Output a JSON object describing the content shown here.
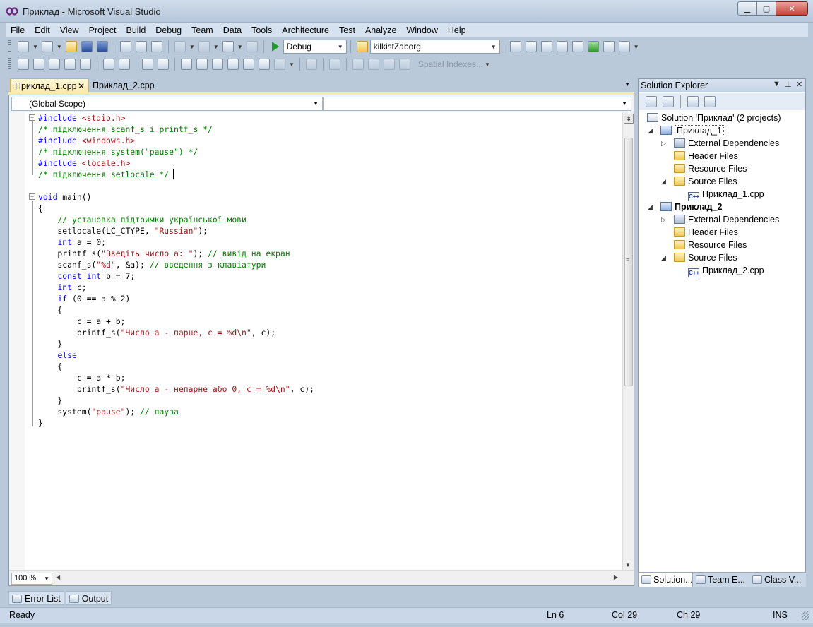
{
  "window": {
    "title": "Приклад - Microsoft Visual Studio",
    "minimize": "▁",
    "maximize": "▢",
    "close": "✕"
  },
  "menu": [
    "File",
    "Edit",
    "View",
    "Project",
    "Build",
    "Debug",
    "Team",
    "Data",
    "Tools",
    "Architecture",
    "Test",
    "Analyze",
    "Window",
    "Help"
  ],
  "toolbar": {
    "configuration": "Debug",
    "find_combo": "kilkistZaborg",
    "spatial_indexes": "Spatial Indexes..."
  },
  "tabs": [
    {
      "label": "Приклад_1.cpp",
      "active": true
    },
    {
      "label": "Приклад_2.cpp",
      "active": false
    }
  ],
  "editor": {
    "scope_left": "(Global Scope)",
    "scope_right": "",
    "zoom": "100 %",
    "code_lines": [
      [
        {
          "t": "#include",
          "c": "pp"
        },
        {
          "t": " "
        },
        {
          "t": "<stdio.h>",
          "c": "ang"
        }
      ],
      [
        {
          "t": "/* підключення scanf_s і printf_s */",
          "c": "cm"
        }
      ],
      [
        {
          "t": "#include",
          "c": "pp"
        },
        {
          "t": " "
        },
        {
          "t": "<windows.h>",
          "c": "ang"
        }
      ],
      [
        {
          "t": "/* підключення system(\"pause\") */",
          "c": "cm"
        }
      ],
      [
        {
          "t": "#include",
          "c": "pp"
        },
        {
          "t": " "
        },
        {
          "t": "<locale.h>",
          "c": "ang"
        }
      ],
      [
        {
          "t": "/* підключення setlocale */",
          "c": "cm"
        },
        {
          "t": "",
          "caret": true
        }
      ],
      [
        {
          "t": ""
        }
      ],
      [
        {
          "t": "void",
          "c": "kw"
        },
        {
          "t": " main()"
        }
      ],
      [
        {
          "t": "{"
        }
      ],
      [
        {
          "t": "    "
        },
        {
          "t": "// установка підтримки української мови",
          "c": "cm"
        }
      ],
      [
        {
          "t": "    setlocale(LC_CTYPE, "
        },
        {
          "t": "\"Russian\"",
          "c": "st"
        },
        {
          "t": ");"
        }
      ],
      [
        {
          "t": "    "
        },
        {
          "t": "int",
          "c": "kw"
        },
        {
          "t": " a = 0;"
        }
      ],
      [
        {
          "t": "    printf_s("
        },
        {
          "t": "\"Введіть число a: \"",
          "c": "st"
        },
        {
          "t": "); "
        },
        {
          "t": "// вивід на екран",
          "c": "cm"
        }
      ],
      [
        {
          "t": "    scanf_s("
        },
        {
          "t": "\"%d\"",
          "c": "st"
        },
        {
          "t": ", &a); "
        },
        {
          "t": "// введення з клавіатури",
          "c": "cm"
        }
      ],
      [
        {
          "t": "    "
        },
        {
          "t": "const",
          "c": "kw"
        },
        {
          "t": " "
        },
        {
          "t": "int",
          "c": "kw"
        },
        {
          "t": " b = 7;"
        }
      ],
      [
        {
          "t": "    "
        },
        {
          "t": "int",
          "c": "kw"
        },
        {
          "t": " c;"
        }
      ],
      [
        {
          "t": "    "
        },
        {
          "t": "if",
          "c": "kw"
        },
        {
          "t": " (0 == a % 2)"
        }
      ],
      [
        {
          "t": "    {"
        }
      ],
      [
        {
          "t": "        c = a + b;"
        }
      ],
      [
        {
          "t": "        printf_s("
        },
        {
          "t": "\"Число a - парне, c = %d\\n\"",
          "c": "st"
        },
        {
          "t": ", c);"
        }
      ],
      [
        {
          "t": "    }"
        }
      ],
      [
        {
          "t": "    "
        },
        {
          "t": "else",
          "c": "kw"
        }
      ],
      [
        {
          "t": "    {"
        }
      ],
      [
        {
          "t": "        c = a * b;"
        }
      ],
      [
        {
          "t": "        printf_s("
        },
        {
          "t": "\"Число a - непарне або 0, c = %d\\n\"",
          "c": "st"
        },
        {
          "t": ", c);"
        }
      ],
      [
        {
          "t": "    }"
        }
      ],
      [
        {
          "t": "    system("
        },
        {
          "t": "\"pause\"",
          "c": "st"
        },
        {
          "t": "); "
        },
        {
          "t": "// пауза",
          "c": "cm"
        }
      ],
      [
        {
          "t": "}"
        }
      ]
    ]
  },
  "solution_explorer": {
    "title": "Solution Explorer",
    "solution": "Solution 'Приклад' (2 projects)",
    "projects": [
      {
        "name": "Приклад_1",
        "items": [
          "External Dependencies",
          "Header Files",
          "Resource Files",
          "Source Files"
        ],
        "source_file": "Приклад_1.cpp"
      },
      {
        "name": "Приклад_2",
        "items": [
          "External Dependencies",
          "Header Files",
          "Resource Files",
          "Source Files"
        ],
        "source_file": "Приклад_2.cpp"
      }
    ],
    "bottom_tabs": [
      "Solution...",
      "Team E...",
      "Class V..."
    ]
  },
  "tool_tabs": [
    "Error List",
    "Output"
  ],
  "status": {
    "message": "Ready",
    "line": "Ln 6",
    "col": "Col 29",
    "ch": "Ch 29",
    "mode": "INS"
  }
}
